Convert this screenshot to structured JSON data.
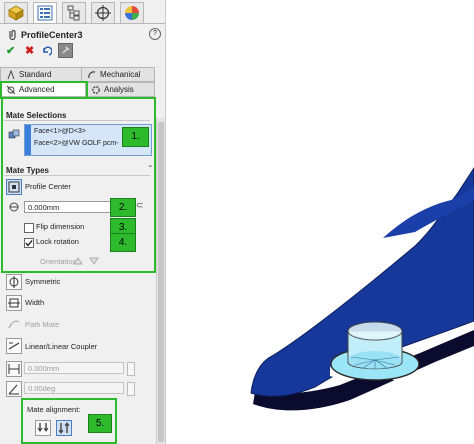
{
  "toolbar_tabs": [
    {
      "name": "featuremanager-tab"
    },
    {
      "name": "propertymanager-tab"
    },
    {
      "name": "configurationmanager-tab"
    },
    {
      "name": "dimxpert-tab"
    },
    {
      "name": "display-manager-tab"
    }
  ],
  "header": {
    "title": "ProfileCenter3",
    "help": "?"
  },
  "tabs": {
    "standard": "Standard",
    "mechanical": "Mechanical",
    "advanced": "Advanced",
    "analysis": "Analysis"
  },
  "mate_selections": {
    "heading": "Mate Selections",
    "items": [
      "Face<1>@D<3>",
      "Face<2>@VW GOLF pcm-"
    ]
  },
  "mate_types": {
    "heading": "Mate Types",
    "profile_center": "Profile Center",
    "offset_value": "0.000mm",
    "flip_dimension": "Flip dimension",
    "lock_rotation": "Lock rotation",
    "lock_rotation_checked": true,
    "flip_checked": false,
    "orientation": "Orientation:"
  },
  "other_mates": {
    "symmetric": "Symmetric",
    "width": "Width",
    "path_mate": "Path Mate",
    "linear_coupler": "Linear/Linear Coupler",
    "distance_value": "0.000mm",
    "angle_value": "0.00deg"
  },
  "mate_alignment": {
    "label": "Mate alignment:"
  },
  "callouts": [
    "1.",
    "2.",
    "3.",
    "4.",
    "5."
  ],
  "colors": {
    "accent_green": "#2dbb2d",
    "part_blue": "#16389a",
    "disc_cyan": "#8fe0f4",
    "selection_blue": "#d4e6f8"
  }
}
